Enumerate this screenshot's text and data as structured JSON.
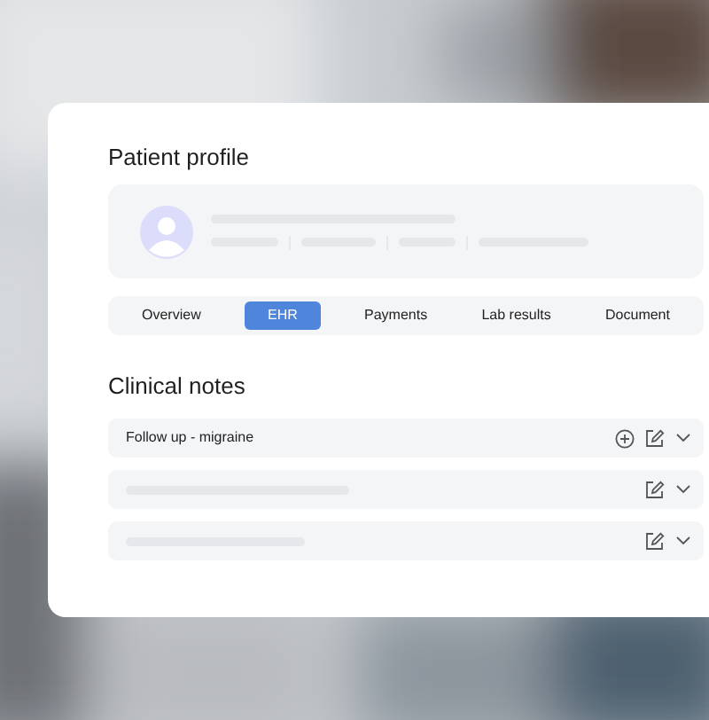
{
  "profile": {
    "title": "Patient profile"
  },
  "tabs": [
    {
      "label": "Overview",
      "selected": false
    },
    {
      "label": "EHR",
      "selected": true
    },
    {
      "label": "Payments",
      "selected": false
    },
    {
      "label": "Lab results",
      "selected": false
    },
    {
      "label": "Document",
      "selected": false
    }
  ],
  "clinical_notes": {
    "title": "Clinical notes",
    "notes": [
      {
        "kind": "text",
        "title": "Follow up - migraine",
        "add_button": true
      },
      {
        "kind": "skeleton",
        "add_button": false
      },
      {
        "kind": "skeleton",
        "add_button": false
      }
    ]
  }
}
